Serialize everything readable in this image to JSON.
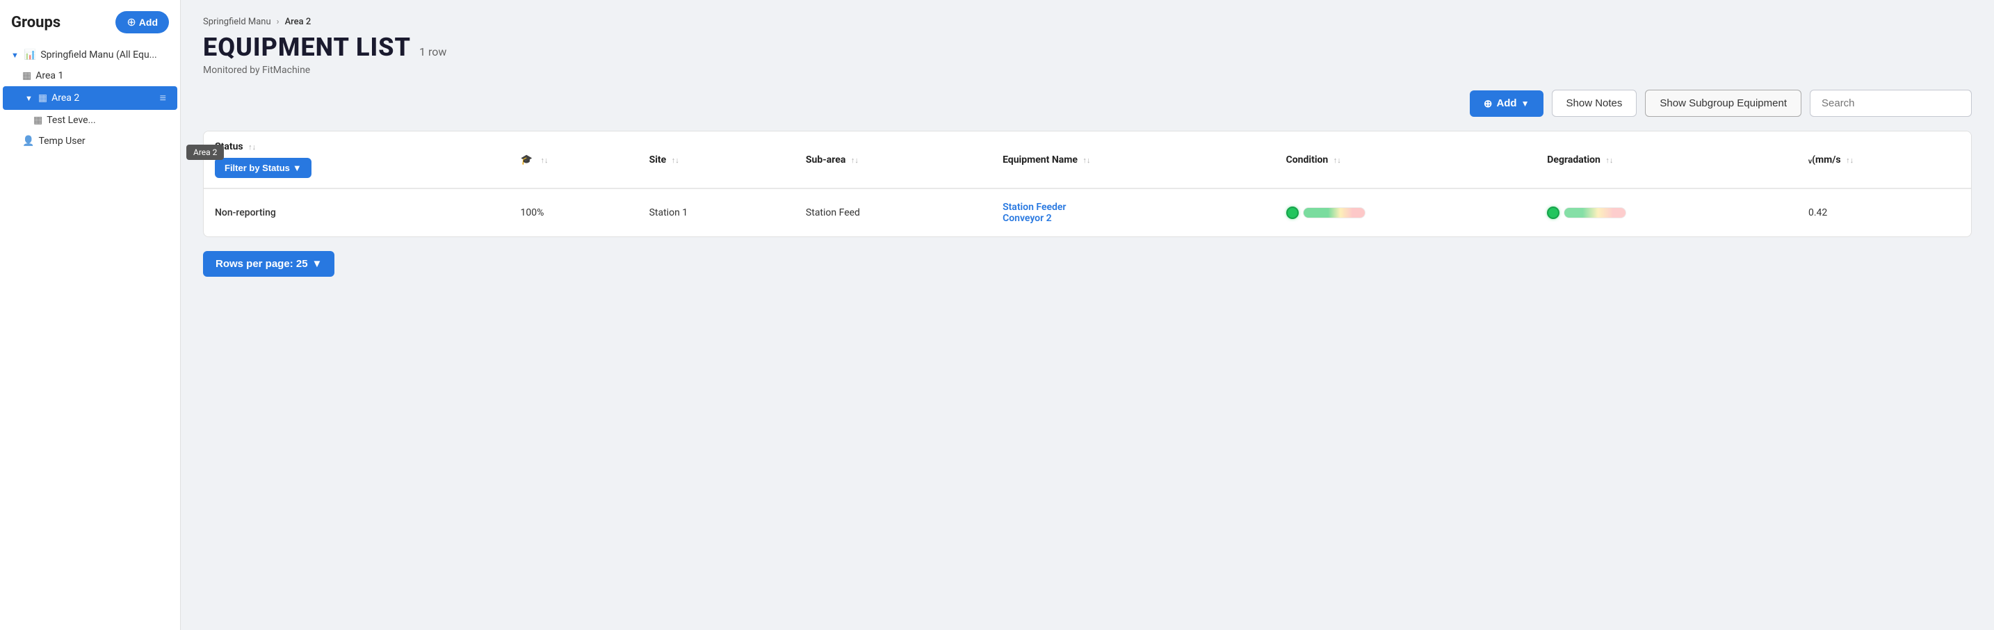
{
  "sidebar": {
    "title": "Groups",
    "add_button": "Add",
    "items": [
      {
        "id": "springfield",
        "label": "Springfield Manu (All Equ...",
        "level": 0,
        "expanded": true,
        "icon": "chart-icon",
        "active": false
      },
      {
        "id": "area1",
        "label": "Area 1",
        "level": 1,
        "icon": "grid-icon",
        "active": false
      },
      {
        "id": "area2",
        "label": "Area 2",
        "level": 1,
        "icon": "grid-icon",
        "active": true,
        "expanded": true,
        "showMenu": true
      },
      {
        "id": "testlevel",
        "label": "Test Leve...",
        "level": 2,
        "icon": "grid-icon",
        "active": false
      },
      {
        "id": "tempuser",
        "label": "Temp User",
        "level": 1,
        "icon": "user-icon",
        "active": false
      }
    ],
    "tooltip": "Area 2"
  },
  "breadcrumb": {
    "parent": "Springfield Manu",
    "separator": "›",
    "current": "Area 2"
  },
  "header": {
    "title": "EQUIPMENT LIST",
    "row_count": "1 row",
    "subtitle": "Monitored by FitMachine"
  },
  "toolbar": {
    "add_button": "Add",
    "show_notes_button": "Show Notes",
    "show_subgroup_button": "Show Subgroup Equipment",
    "search_placeholder": "Search"
  },
  "table": {
    "columns": [
      {
        "id": "status",
        "label": "Status",
        "has_sort": true
      },
      {
        "id": "site_pct",
        "label": "",
        "has_sort": true
      },
      {
        "id": "site",
        "label": "Site",
        "has_sort": true
      },
      {
        "id": "subarea",
        "label": "Sub-area",
        "has_sort": true
      },
      {
        "id": "equipment_name",
        "label": "Equipment Name",
        "has_sort": true
      },
      {
        "id": "condition",
        "label": "Condition",
        "has_sort": true
      },
      {
        "id": "degradation",
        "label": "Degradation",
        "has_sort": true
      },
      {
        "id": "velocity",
        "label": "ᵥᵥ(mm/s",
        "has_sort": true
      }
    ],
    "filter_button": "Filter by Status",
    "rows": [
      {
        "status": "Non-reporting",
        "site_pct": "100%",
        "site": "Station 1",
        "subarea": "Station Feed",
        "equipment_name_line1": "Station Feeder",
        "equipment_name_line2": "Conveyor 2",
        "velocity": "0.42"
      }
    ]
  },
  "pagination": {
    "rows_per_page_label": "Rows per page: 25"
  }
}
